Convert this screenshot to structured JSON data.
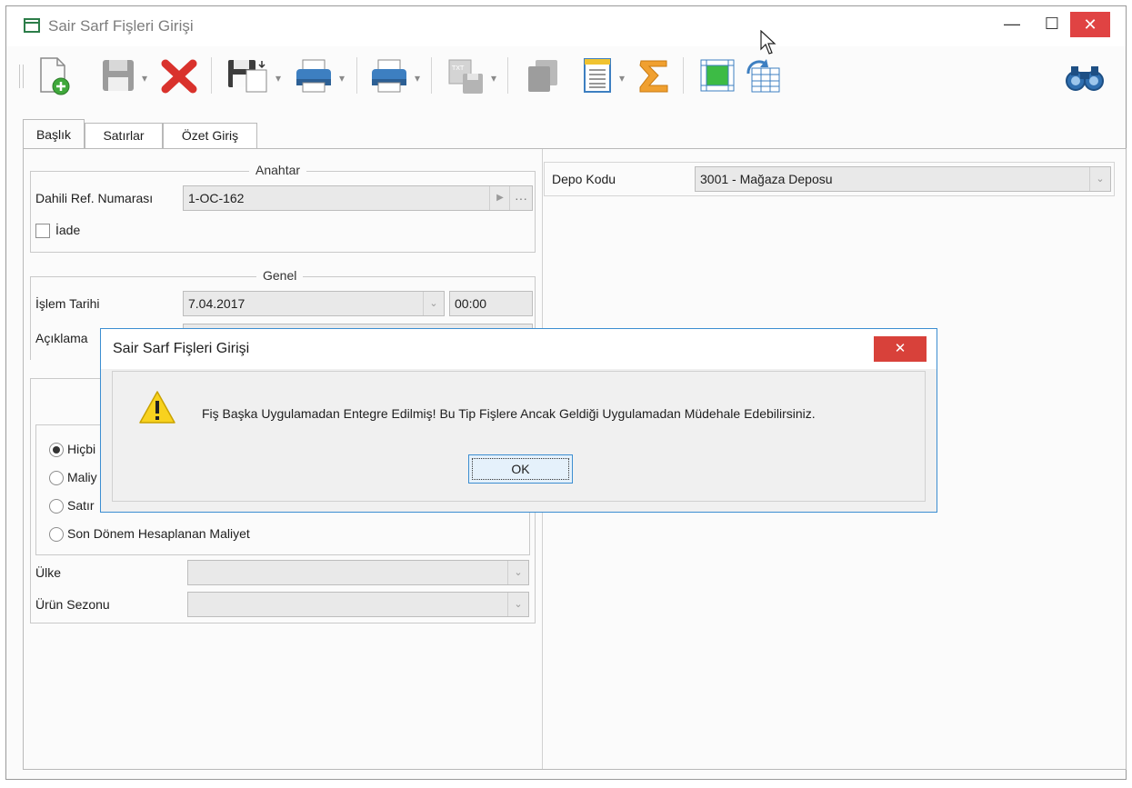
{
  "window": {
    "title": "Sair Sarf Fişleri Girişi"
  },
  "tabs": [
    "Başlık",
    "Satırlar",
    "Özet Giriş"
  ],
  "anahtar": {
    "title": "Anahtar",
    "ref_label": "Dahili Ref. Numarası",
    "ref_value": "1-OC-162",
    "ellipsis": "···",
    "iade_label": "İade"
  },
  "genel": {
    "title": "Genel",
    "islem_tarihi_label": "İşlem Tarihi",
    "date_value": "7.04.2017",
    "time_value": "00:00",
    "aciklama_label": "Açıklama"
  },
  "cost_options": [
    "Hiçbi",
    "Maliy",
    "Satır",
    "Son Dönem Hesaplanan Maliyet"
  ],
  "ulke_label": "Ülke",
  "urun_sezonu_label": "Ürün Sezonu",
  "depo": {
    "label": "Depo Kodu",
    "value": "3001 - Mağaza Deposu"
  },
  "dialog": {
    "title": "Sair Sarf Fişleri Girişi",
    "message": "Fiş Başka Uygulamadan Entegre Edilmiş! Bu Tip Fişlere Ancak Geldiği Uygulamadan Müdehale Edebilirsiniz.",
    "ok_label": "OK",
    "close_glyph": "✕"
  },
  "toolbar": {
    "icons": [
      "new-document-icon",
      "save-icon",
      "delete-icon",
      "save-as-icon",
      "print-icon",
      "print-preview-icon",
      "txt-export-icon",
      "copy-icon",
      "report-icon",
      "sum-icon",
      "table-icon",
      "refresh-table-icon",
      "find-icon"
    ]
  },
  "colors": {
    "dialog_border": "#3c8ed1",
    "close_red": "#e04343",
    "app_green": "#2c7d49"
  }
}
